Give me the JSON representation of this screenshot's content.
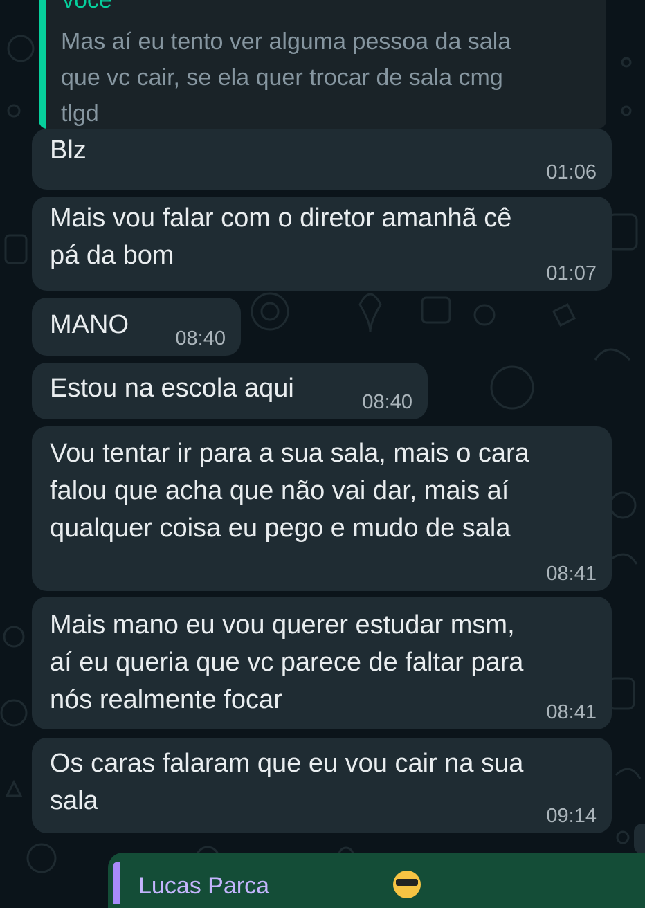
{
  "colors": {
    "background": "#0b141a",
    "incoming_bubble": "#1f2c33",
    "outgoing_bubble": "#144d37",
    "quote_accent": "#06cf9c",
    "text": "#e9edef",
    "timestamp": "#aab4ba"
  },
  "quoted_reply": {
    "author": "você",
    "text": "Mas aí eu tento ver alguma pessoa da sala\nque vc cair, se ela quer trocar de sala cmg\ntlgd"
  },
  "messages": [
    {
      "text": "Blz",
      "time": "01:06"
    },
    {
      "text": "Mais vou falar com o diretor amanhã cê\npá da bom",
      "time": "01:07"
    },
    {
      "text": "MANO",
      "time": "08:40"
    },
    {
      "text": "Estou na escola aqui",
      "time": "08:40"
    },
    {
      "text": "Vou tentar ir para a sua sala, mais o cara\nfalou que acha que não vai dar, mais aí\nqualquer coisa eu pego e mudo de sala",
      "time": "08:41"
    },
    {
      "text": "Mais mano eu vou querer estudar msm,\naí eu queria que vc parece de faltar para\nnós realmente focar",
      "time": "08:41"
    },
    {
      "text": "Os caras falaram que eu vou cair na sua\nsala",
      "time": "09:14"
    }
  ],
  "outgoing_reply": {
    "author": "Lucas Parca",
    "emoji": "sunglasses-emoji"
  }
}
